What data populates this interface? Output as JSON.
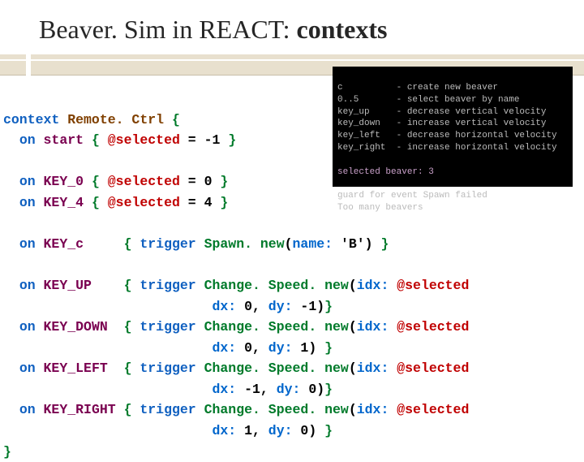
{
  "title": {
    "pre": "Beaver. Sim in REACT: ",
    "bold": "contexts"
  },
  "terminal": {
    "lines": [
      "c          - create new beaver",
      "0..5       - select beaver by name",
      "key_up     - decrease vertical velocity",
      "key_down   - increase vertical velocity",
      "key_left   - decrease horizontal velocity",
      "key_right  - increase horizontal velocity",
      "",
      "selected beaver: 3",
      "",
      "guard for event Spawn failed",
      "Too many beavers"
    ]
  },
  "code": {
    "kw_context": "context",
    "name": "Remote. Ctrl",
    "kw_on": "on",
    "kw_trigger": "trigger",
    "ev_start": "start",
    "ev_key0": "KEY_0",
    "ev_key4": "KEY_4",
    "ev_keyc": "KEY_c",
    "ev_keyup": "KEY_UP",
    "ev_keydn": "KEY_DOWN",
    "ev_keylf": "KEY_LEFT",
    "ev_keyrt": "KEY_RIGHT",
    "var_sel": "@selected",
    "call_spawn": "Spawn. new",
    "call_cs": "Change. Speed. new",
    "arg_name": "name:",
    "arg_idx": "idx:",
    "arg_dx": "dx:",
    "arg_dy": "dy:",
    "val_b": "'B'",
    "n_start": "-1",
    "n_0": "0",
    "n_4": "4",
    "n_m1": "-1",
    "n_1": "1"
  }
}
